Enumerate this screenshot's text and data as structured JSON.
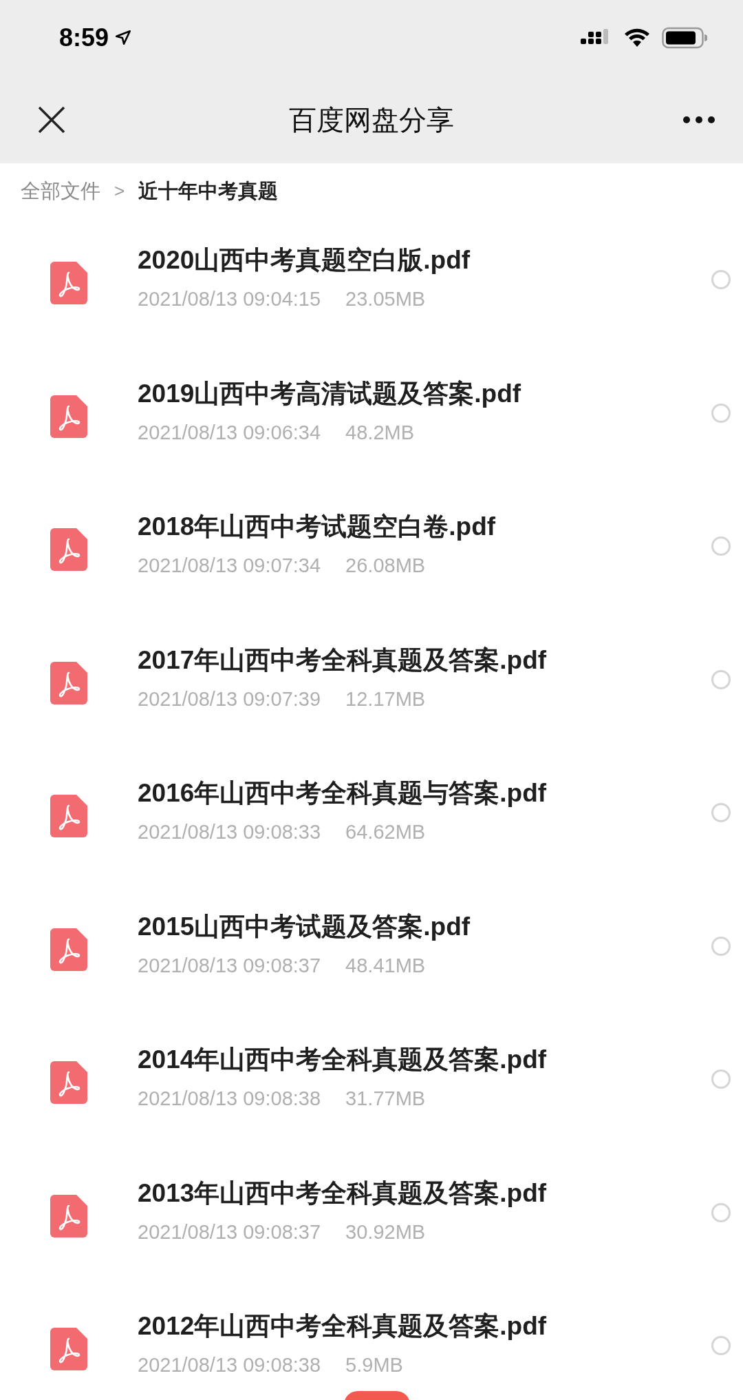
{
  "status_bar": {
    "time": "8:59"
  },
  "nav_bar": {
    "title": "百度网盘分享"
  },
  "breadcrumb": {
    "items": [
      {
        "label": "全部文件",
        "current": false
      },
      {
        "label": "近十年中考真题",
        "current": true
      }
    ],
    "separator": ">"
  },
  "files": [
    {
      "name": "2020山西中考真题空白版.pdf",
      "date": "2021/08/13 09:04:15",
      "size": "23.05MB",
      "selected": false
    },
    {
      "name": "2019山西中考高清试题及答案.pdf",
      "date": "2021/08/13 09:06:34",
      "size": "48.2MB",
      "selected": false
    },
    {
      "name": "2018年山西中考试题空白卷.pdf",
      "date": "2021/08/13 09:07:34",
      "size": "26.08MB",
      "selected": false
    },
    {
      "name": "2017年山西中考全科真题及答案.pdf",
      "date": "2021/08/13 09:07:39",
      "size": "12.17MB",
      "selected": false
    },
    {
      "name": "2016年山西中考全科真题与答案.pdf",
      "date": "2021/08/13 09:08:33",
      "size": "64.62MB",
      "selected": false
    },
    {
      "name": "2015山西中考试题及答案.pdf",
      "date": "2021/08/13 09:08:37",
      "size": "48.41MB",
      "selected": false
    },
    {
      "name": "2014年山西中考全科真题及答案.pdf",
      "date": "2021/08/13 09:08:38",
      "size": "31.77MB",
      "selected": false
    },
    {
      "name": "2013年山西中考全科真题及答案.pdf",
      "date": "2021/08/13 09:08:37",
      "size": "30.92MB",
      "selected": false
    },
    {
      "name": "2012年山西中考全科真题及答案.pdf",
      "date": "2021/08/13 09:08:38",
      "size": "5.9MB",
      "selected": false
    }
  ]
}
